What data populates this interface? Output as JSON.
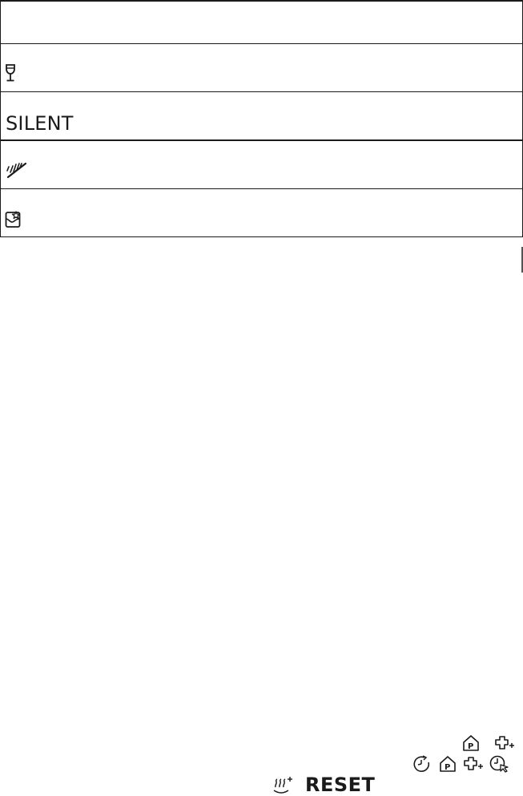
{
  "table": {
    "rows": [
      {
        "id": "row-blank",
        "icon": "",
        "label": ""
      },
      {
        "id": "row-glass",
        "icon": "wine-glass-icon",
        "label": ""
      },
      {
        "id": "row-silent",
        "icon": "",
        "label": "SILENT"
      },
      {
        "id": "row-spray",
        "icon": "spray-arm-icon",
        "label": ""
      },
      {
        "id": "row-dryer",
        "icon": "cleaning-box-icon",
        "label": ""
      }
    ]
  },
  "footer": {
    "reset_label": "RESET",
    "icons_row1": [
      "home-p-icon",
      "puzzle-plus-icon"
    ],
    "icons_row2": [
      "timer-refresh-icon",
      "home-p-icon",
      "puzzle-plus-icon",
      "clock-touch-icon"
    ],
    "steam_icon": "steam-plus-icon"
  }
}
